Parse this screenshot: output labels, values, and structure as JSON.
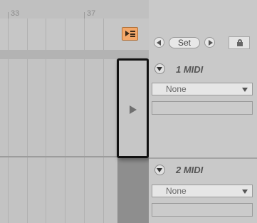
{
  "ruler": {
    "marks": [
      "33",
      "37"
    ]
  },
  "controls": {
    "set_label": "Set"
  },
  "tracks": [
    {
      "name": "1 MIDI",
      "input_value": "None"
    },
    {
      "name": "2 MIDI",
      "input_value": "None"
    }
  ],
  "icons": {
    "expand": "play-triangle-icon",
    "toggle_view": "arrangement-toggle-icon",
    "prev": "arrow-left-icon",
    "next": "arrow-right-icon",
    "lock": "lock-icon",
    "fold": "chevron-down-icon"
  },
  "colors": {
    "toggle_accent": "#f3a86a",
    "highlight_border": "#111111"
  }
}
